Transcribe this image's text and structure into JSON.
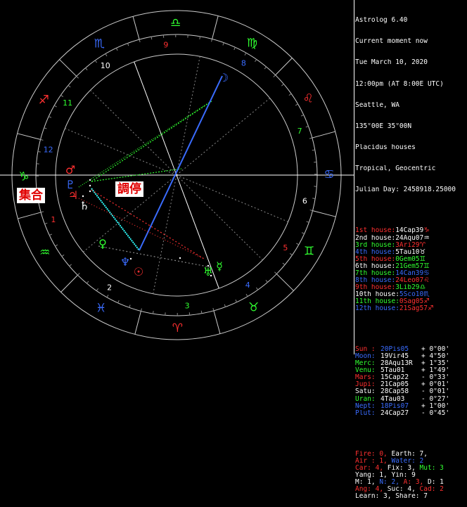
{
  "header": {
    "app": "Astrolog 6.40",
    "subtitle": "Current moment now",
    "date": "Tue March 10, 2020",
    "time": "12:00pm (AT 8:00E UTC)",
    "place": "Seattle, WA",
    "coords": "135°00E 35°00N",
    "house_system": "Placidus houses",
    "zodiac": "Tropical, Geocentric",
    "julian": "Julian Day: 2458918.25000"
  },
  "houses": [
    {
      "label": "1st house:",
      "value": "14Cap39",
      "glyph": "♑",
      "color": "#ff3030"
    },
    {
      "label": "2nd house:",
      "value": "24Aqu07",
      "glyph": "♒",
      "color": "#ffffff"
    },
    {
      "label": "3rd house:",
      "value": "3Ari29",
      "glyph": "♈",
      "color": "#30ff30",
      "value_color": "#ff3030"
    },
    {
      "label": "4th house:",
      "value": "5Tau10",
      "glyph": "♉",
      "color": "#3a6cff",
      "value_color": "#ffffff"
    },
    {
      "label": "5th house:",
      "value": "0Gem05",
      "glyph": "♊",
      "color": "#ff3030",
      "value_color": "#30ff30"
    },
    {
      "label": "6th house:",
      "value": "21Gem57",
      "glyph": "♊",
      "color": "#ffffff",
      "value_color": "#30ff30"
    },
    {
      "label": "7th house:",
      "value": "14Can39",
      "glyph": "♋",
      "color": "#30ff30",
      "value_color": "#3a6cff"
    },
    {
      "label": "8th house:",
      "value": "24Leo07",
      "glyph": "♌",
      "color": "#3a6cff",
      "value_color": "#ff3030"
    },
    {
      "label": "9th house:",
      "value": "3Lib29",
      "glyph": "♎",
      "color": "#ff3030",
      "value_color": "#30ff30"
    },
    {
      "label": "10th house:",
      "value": "5Sco10",
      "glyph": "♏",
      "color": "#ffffff",
      "value_color": "#3a6cff"
    },
    {
      "label": "11th house:",
      "value": "0Sag05",
      "glyph": "♐",
      "color": "#30ff30",
      "value_color": "#ff3030"
    },
    {
      "label": "12th house:",
      "value": "21Sag57",
      "glyph": "♐",
      "color": "#3a6cff",
      "value_color": "#ff3030"
    }
  ],
  "planets": [
    {
      "name": "Sun :",
      "pos": "20Pis05",
      "speed": "+ 0°00'",
      "color": "#ff3030",
      "pos_color": "#3a6cff"
    },
    {
      "name": "Moon:",
      "pos": "19Vir45",
      "speed": "+ 4°50'",
      "color": "#3a6cff",
      "pos_color": "#ffffff"
    },
    {
      "name": "Merc:",
      "pos": "28Aqu13R",
      "speed": "+ 1°35'",
      "color": "#30ff30",
      "pos_color": "#ffffff"
    },
    {
      "name": "Venu:",
      "pos": "5Tau01",
      "speed": "+ 1°49'",
      "color": "#30ff30",
      "pos_color": "#ffffff"
    },
    {
      "name": "Mars:",
      "pos": "15Cap22",
      "speed": "- 0°33'",
      "color": "#ff3030",
      "pos_color": "#ffffff"
    },
    {
      "name": "Jupi:",
      "pos": "21Cap05",
      "speed": "+ 0°01'",
      "color": "#ff3030",
      "pos_color": "#ffffff"
    },
    {
      "name": "Satu:",
      "pos": "28Cap58",
      "speed": "- 0°01'",
      "color": "#ffffff",
      "pos_color": "#ffffff"
    },
    {
      "name": "Uran:",
      "pos": "4Tau03",
      "speed": "- 0°27'",
      "color": "#30ff30",
      "pos_color": "#ffffff"
    },
    {
      "name": "Nept:",
      "pos": "18Pis07",
      "speed": "+ 1°00'",
      "color": "#3a6cff",
      "pos_color": "#3a6cff"
    },
    {
      "name": "Plut:",
      "pos": "24Cap27",
      "speed": "- 0°45'",
      "color": "#3a6cff",
      "pos_color": "#ffffff"
    }
  ],
  "elements": {
    "line1": [
      {
        "t": "Fire: 0, ",
        "c": "#ff3030"
      },
      {
        "t": "Earth: 7,",
        "c": "#ffffff"
      }
    ],
    "line2": [
      {
        "t": "Air : 1, ",
        "c": "#ff3030"
      },
      {
        "t": "Water: 2",
        "c": "#3a6cff"
      }
    ],
    "line3": [
      {
        "t": "Car: 4, ",
        "c": "#ff3030"
      },
      {
        "t": "Fix: 3, ",
        "c": "#ffffff"
      },
      {
        "t": "Mut: 3",
        "c": "#30ff30"
      }
    ],
    "line4": [
      {
        "t": "Yang: 1, Yin: 9",
        "c": "#ffffff"
      }
    ],
    "line5": [
      {
        "t": "M: 1, ",
        "c": "#ffffff"
      },
      {
        "t": "N: 2, ",
        "c": "#3a6cff"
      },
      {
        "t": "A: 3, ",
        "c": "#ff3030"
      },
      {
        "t": "D: 1",
        "c": "#ffffff"
      }
    ],
    "line6": [
      {
        "t": "Ang: 4, ",
        "c": "#ff3030"
      },
      {
        "t": "Suc: 4, ",
        "c": "#ffffff"
      },
      {
        "t": "Cad: 2",
        "c": "#ff3030"
      }
    ],
    "line7": [
      {
        "t": "Learn: 3, Share: 7",
        "c": "#ffffff"
      }
    ]
  },
  "annotations": {
    "conjunction": "集合",
    "mediation": "調停"
  },
  "wheel": {
    "house_numbers": [
      "1",
      "2",
      "3",
      "4",
      "5",
      "6",
      "7",
      "8",
      "9",
      "10",
      "11",
      "12"
    ],
    "signs": [
      "♈",
      "♉",
      "♊",
      "♋",
      "♌",
      "♍",
      "♎",
      "♏",
      "♐",
      "♑",
      "♒",
      "♓"
    ],
    "sign_colors": [
      "#ff3030",
      "#30ff30",
      "#30ff30",
      "#3a6cff",
      "#ff3030",
      "#30ff30",
      "#30ff30",
      "#3a6cff",
      "#ff3030",
      "#30ff30",
      "#30ff30",
      "#3a6cff"
    ],
    "planet_glyphs": {
      "sun": "☉",
      "moon": "☽",
      "mercury": "☿",
      "venus": "♀",
      "mars": "♂",
      "jupiter": "♃",
      "saturn": "♄",
      "uranus": "♅",
      "neptune": "♆",
      "pluto": "♇"
    }
  }
}
